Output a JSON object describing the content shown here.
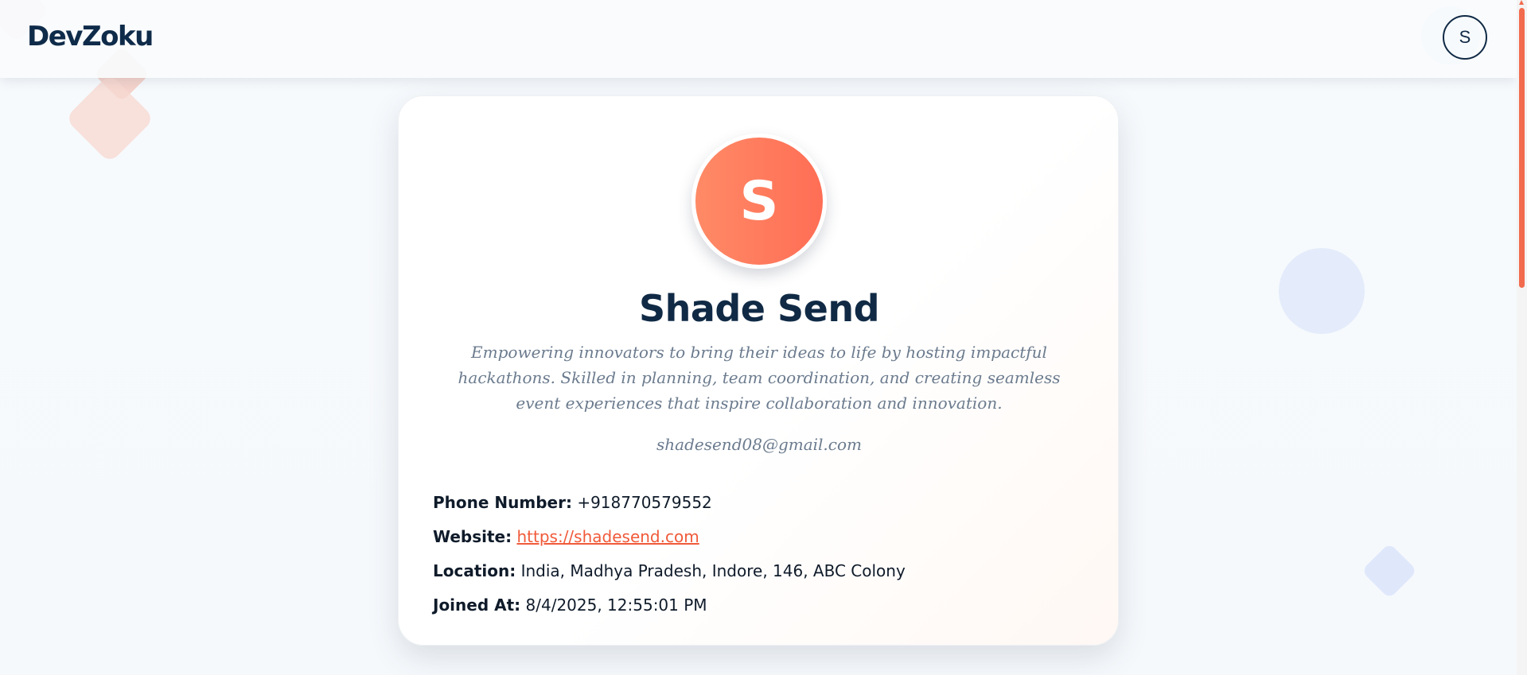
{
  "app": {
    "logo": "DevZoku"
  },
  "header": {
    "user_initial": "S"
  },
  "profile": {
    "initial": "S",
    "name": "Shade Send",
    "bio": "Empowering innovators to bring their ideas to life by hosting impactful hackathons. Skilled in planning, team coordination, and creating seamless event experiences that inspire collaboration and innovation.",
    "email": "shadesend08@gmail.com",
    "details": {
      "phone_label": "Phone Number:",
      "phone_value": "+918770579552",
      "website_label": "Website:",
      "website_value": "https://shadesend.com",
      "location_label": "Location:",
      "location_value": "India, Madhya Pradesh, Indore, 146, ABC Colony",
      "joined_label": "Joined At:",
      "joined_value": "8/4/2025, 12:55:01 PM"
    }
  },
  "colors": {
    "accent": "#f26b4e",
    "navy": "#102a45",
    "muted": "#6b7b8e"
  }
}
